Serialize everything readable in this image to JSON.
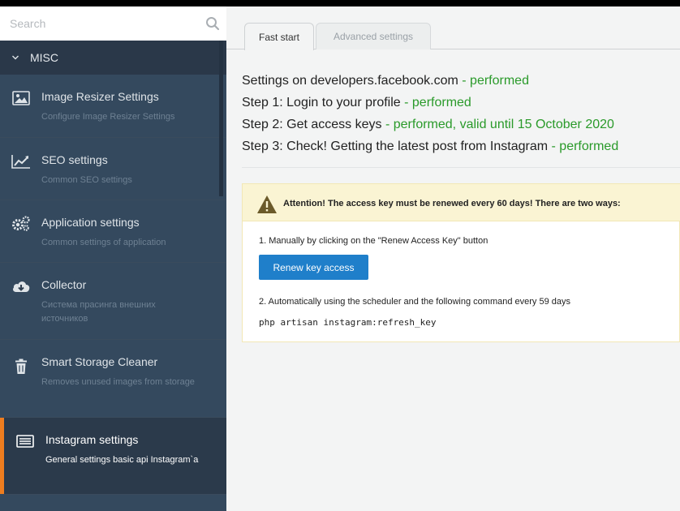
{
  "search": {
    "placeholder": "Search"
  },
  "sidebar": {
    "section_label": "MISC",
    "items": [
      {
        "title": "Image Resizer Settings",
        "subtitle": "Configure Image Resizer Settings",
        "icon": "image-icon"
      },
      {
        "title": "SEO settings",
        "subtitle": "Common SEO settings",
        "icon": "chart-line-icon"
      },
      {
        "title": "Application settings",
        "subtitle": "Common settings of application",
        "icon": "gears-icon"
      },
      {
        "title": "Collector",
        "subtitle": "Система прасинга внешних источников",
        "icon": "cloud-download-icon"
      },
      {
        "title": "Smart Storage Cleaner",
        "subtitle": "Removes unused images from storage",
        "icon": "trash-icon"
      },
      {
        "title": "Instagram settings",
        "subtitle": "General settings basic api Instagram`a",
        "icon": "list-card-icon",
        "active": true
      }
    ]
  },
  "tabs": [
    {
      "label": "Fast start",
      "active": true
    },
    {
      "label": "Advanced settings",
      "active": false
    }
  ],
  "steps": [
    {
      "text": "Settings on developers.facebook.com",
      "status": " - performed"
    },
    {
      "text": "Step 1: Login to your profile",
      "status": " - performed"
    },
    {
      "text": "Step 2: Get access keys",
      "status": " - performed, valid until 15 October 2020"
    },
    {
      "text": "Step 3: Check! Getting the latest post from Instagram",
      "status": " - performed"
    }
  ],
  "notice": {
    "title": "Attention! The access key must be renewed every 60 days! There are two ways:",
    "way1": "1. Manually by clicking on the \"Renew Access Key\" button",
    "button_label": "Renew key access",
    "way2": "2. Automatically using the scheduler and the following command every 59 days",
    "command": "php artisan instagram:refresh_key"
  },
  "colors": {
    "sidebar_bg": "#34495e",
    "accent": "#ee7d1f",
    "success": "#2a9a2a",
    "button": "#1f7fca",
    "warning_bg": "#faf4d3"
  }
}
